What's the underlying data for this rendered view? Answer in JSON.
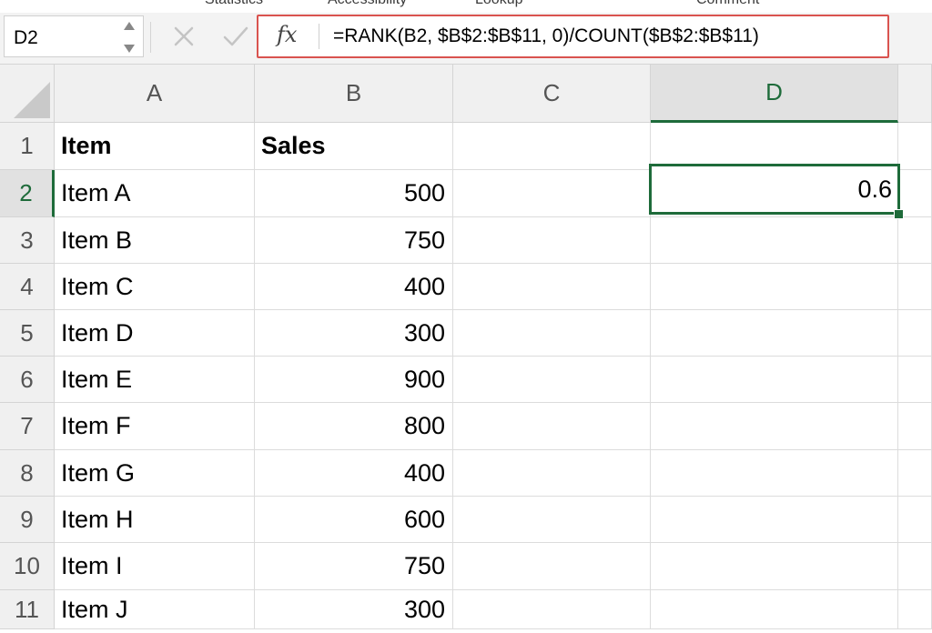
{
  "ribbon": {
    "tabs": [
      "Statistics",
      "Accessibility",
      "Lookup",
      "Comment"
    ]
  },
  "formula_bar": {
    "name_box": "D2",
    "cancel_icon": "close-icon",
    "enter_icon": "check-icon",
    "fx_label": "fx",
    "formula": "=RANK(B2, $B$2:$B$11, 0)/COUNT($B$2:$B$11)"
  },
  "columns": [
    "A",
    "B",
    "C",
    "D"
  ],
  "rows": [
    "1",
    "2",
    "3",
    "4",
    "5",
    "6",
    "7",
    "8",
    "9",
    "10",
    "11"
  ],
  "header_row": {
    "item": "Item",
    "sales": "Sales"
  },
  "data_rows": [
    {
      "item": "Item A",
      "sales": "500"
    },
    {
      "item": "Item B",
      "sales": "750"
    },
    {
      "item": "Item C",
      "sales": "400"
    },
    {
      "item": "Item D",
      "sales": "300"
    },
    {
      "item": "Item E",
      "sales": "900"
    },
    {
      "item": "Item F",
      "sales": "800"
    },
    {
      "item": "Item G",
      "sales": "400"
    },
    {
      "item": "Item H",
      "sales": "600"
    },
    {
      "item": "Item I",
      "sales": "750"
    },
    {
      "item": "Item J",
      "sales": "300"
    }
  ],
  "selected_cell": {
    "ref": "D2",
    "value": "0.6"
  },
  "colors": {
    "selection": "#1e6b3a",
    "formula_highlight": "#d9534f"
  }
}
